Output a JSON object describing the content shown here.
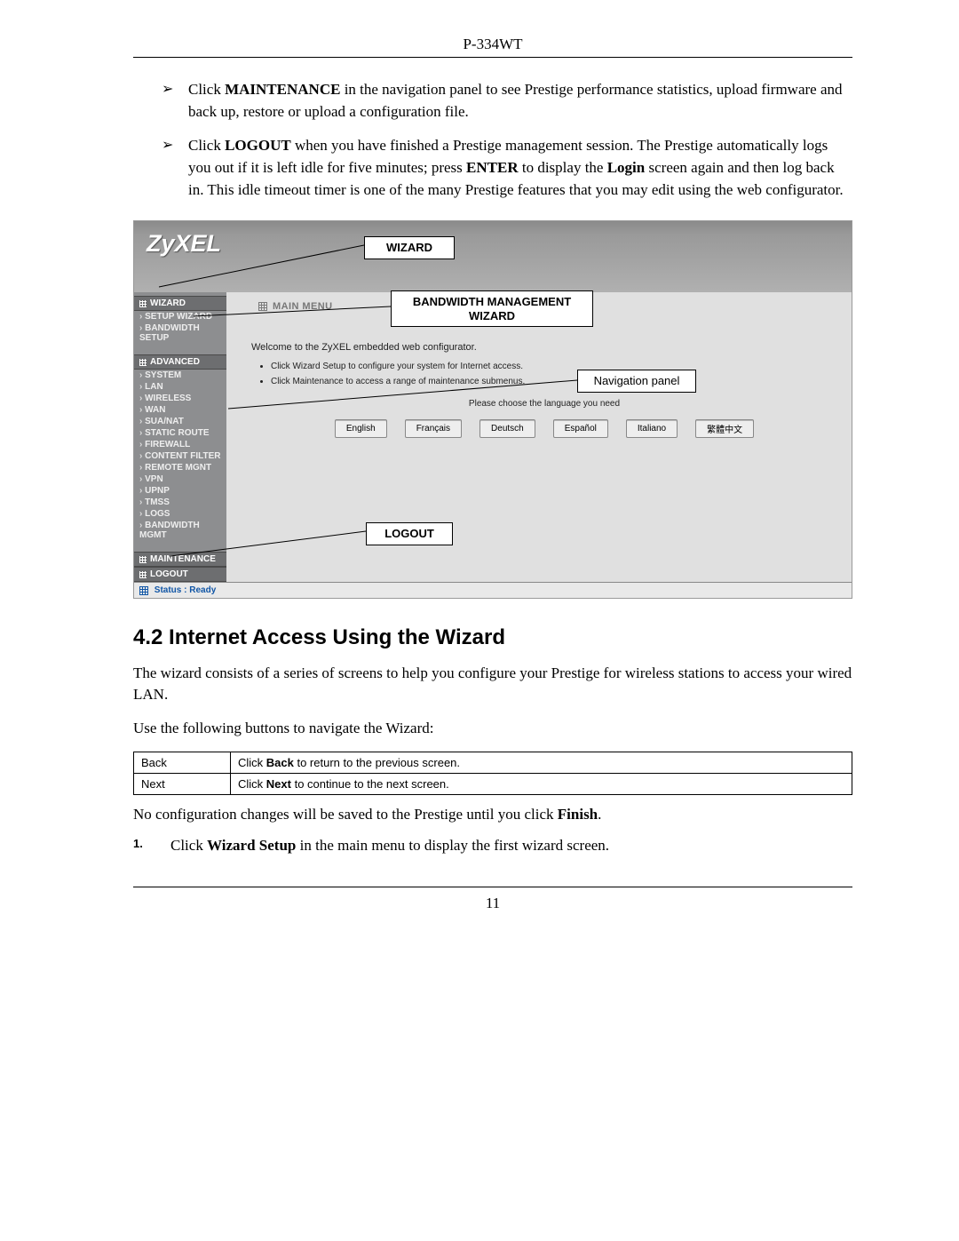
{
  "header": {
    "model": "P-334WT",
    "page_number": "11"
  },
  "bullets": [
    {
      "pre": "Click ",
      "bold1": "MAINTENANCE",
      "post": " in the navigation panel to see Prestige performance statistics, upload firmware and back up, restore or upload a configuration file."
    },
    {
      "pre": "Click ",
      "bold1": "LOGOUT",
      "mid1": " when you have finished a Prestige management session. The Prestige automatically logs you out if it is left idle for five minutes; press ",
      "bold2": "ENTER",
      "mid2": " to display the ",
      "bold3": "Login",
      "post": " screen again and then log back in. This idle timeout timer is one of the many Prestige features that you may edit using the web configurator."
    }
  ],
  "callouts": {
    "wizard": "WIZARD",
    "bw": "BANDWIDTH MANAGEMENT WIZARD",
    "navpanel": "Navigation panel",
    "logout": "LOGOUT"
  },
  "app": {
    "brand": "ZyXEL",
    "crumb": "MAIN MENU",
    "welcome": "Welcome to the ZyXEL embedded web configurator.",
    "instr": [
      "Click Wizard Setup to configure your system for Internet access.",
      "Click Maintenance to access a range of maintenance submenus."
    ],
    "lang_prompt": "Please choose the language you need",
    "langs": [
      "English",
      "Français",
      "Deutsch",
      "Español",
      "Italiano",
      "繁體中文"
    ],
    "status_label": "Status :",
    "status_value": "Ready",
    "sidebar": {
      "sections": [
        {
          "title": "WIZARD",
          "items": [
            "SETUP WIZARD",
            "BANDWIDTH SETUP"
          ]
        },
        {
          "title": "ADVANCED",
          "items": [
            "SYSTEM",
            "LAN",
            "WIRELESS",
            "WAN",
            "SUA/NAT",
            "STATIC ROUTE",
            "FIREWALL",
            "CONTENT FILTER",
            "REMOTE MGNT",
            "VPN",
            "UPNP",
            "TMSS",
            "LOGS",
            "BANDWIDTH MGMT"
          ]
        },
        {
          "title": "MAINTENANCE",
          "items": []
        },
        {
          "title": "LOGOUT",
          "items": []
        }
      ]
    }
  },
  "section": {
    "heading": "4.2 Internet Access Using the Wizard",
    "p1": "The wizard consists of a series of screens to help you configure your Prestige for wireless stations to access your wired LAN.",
    "p2": "Use the following buttons to navigate the Wizard:",
    "table": [
      {
        "c1": "Back",
        "c2_pre": "Click ",
        "c2_b": "Back",
        "c2_post": " to return to the previous screen."
      },
      {
        "c1": "Next",
        "c2_pre": "Click ",
        "c2_b": "Next",
        "c2_post": " to continue to the next screen."
      }
    ],
    "p3_pre": "No configuration changes will be saved to the Prestige until you click ",
    "p3_b": "Finish",
    "p3_post": ".",
    "step_no": "1.",
    "step_pre": "Click ",
    "step_b": "Wizard Setup",
    "step_post": " in the main menu to display the first wizard screen."
  }
}
